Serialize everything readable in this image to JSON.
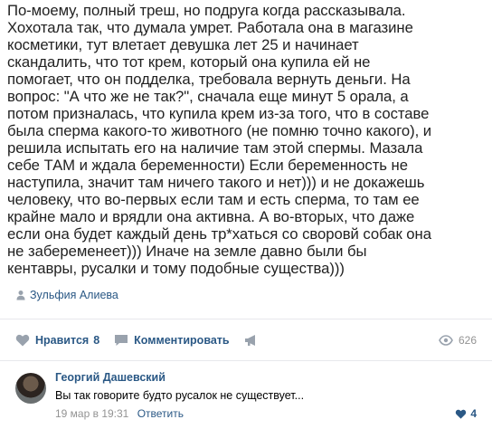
{
  "post": {
    "lines": [
      "По-моему, полный треш, но подруга когда рассказывала.",
      "Хохотала так, что думала умрет. Работала она в магазине",
      "косметики, тут влетает девушка лет 25 и начинает",
      "скандалить, что тот крем, который она купила ей не",
      "помогает, что он подделка, требовала вернуть деньги. На",
      "вопрос: \"А что же не так?\", сначала еще минут 5 орала, а",
      "потом призналась, что купила крем из-за того, что в составе",
      "была сперма какого-то животного (не помню точно какого), и",
      "решила испытать его на наличие там этой спермы. Мазала",
      "себе ТАМ и ждала беременности) Если беременность не",
      "наступила, значит там ничего такого и нет))) и не докажешь",
      "человеку, что во-первых если там и есть сперма, то там ее",
      "крайне мало и врядли она активна. А во-вторых, что даже",
      "если она будет каждый день тр*хаться со своровй собак она",
      "не забеременеет))) Иначе на земле давно были бы",
      "кентавры, русалки и тому подобные существа)))"
    ],
    "author": "Зульфия Алиева"
  },
  "actions": {
    "like_label": "Нравится",
    "like_count": "8",
    "comment_label": "Комментировать",
    "views": "626"
  },
  "comment": {
    "author": "Георгий Дашевский",
    "text": "Вы так говорите будто русалок не существует...",
    "date": "19 мар в 19:31",
    "reply": "Ответить",
    "likes": "4"
  },
  "colors": {
    "link": "#2a5885",
    "muted": "#939393",
    "icon": "#99a2ad"
  }
}
